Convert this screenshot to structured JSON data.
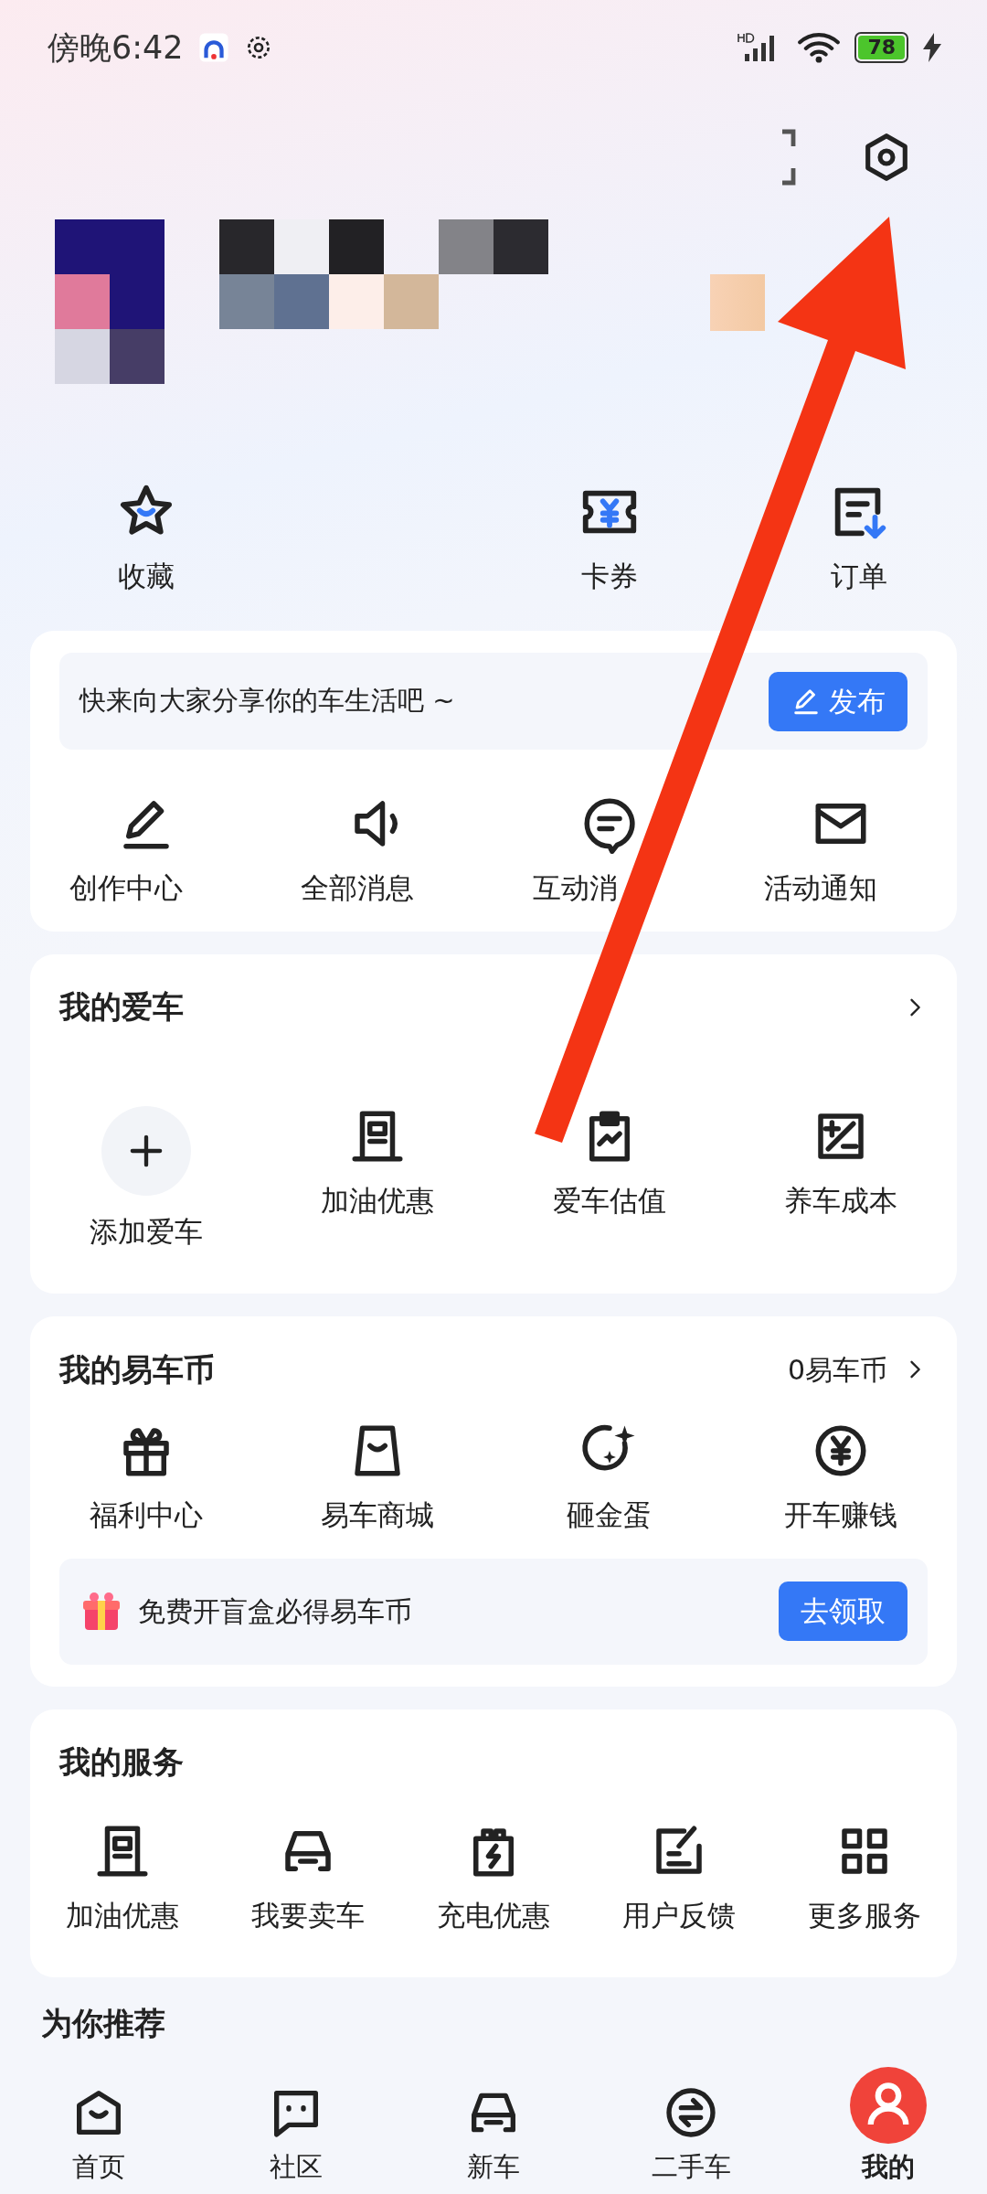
{
  "status_bar": {
    "time": "傍晚6:42",
    "battery": "78"
  },
  "quick_links": [
    {
      "label": "收藏"
    },
    {
      "label": "卡券"
    },
    {
      "label": "订单"
    }
  ],
  "share": {
    "prompt": "快来向大家分享你的车生活吧 ~",
    "button": "发布"
  },
  "messages": [
    {
      "label": "创作中心"
    },
    {
      "label": "全部消息"
    },
    {
      "label": "互动消"
    },
    {
      "label": "活动通知"
    }
  ],
  "my_car": {
    "title": "我的爱车",
    "items": [
      {
        "label": "添加爱车"
      },
      {
        "label": "加油优惠"
      },
      {
        "label": "爱车估值"
      },
      {
        "label": "养车成本"
      }
    ]
  },
  "coins": {
    "title": "我的易车币",
    "balance": "0易车币",
    "items": [
      {
        "label": "福利中心"
      },
      {
        "label": "易车商城"
      },
      {
        "label": "砸金蛋"
      },
      {
        "label": "开车赚钱"
      }
    ],
    "promo": {
      "text": "免费开盲盒必得易车币",
      "button": "去领取"
    }
  },
  "services": {
    "title": "我的服务",
    "items": [
      {
        "label": "加油优惠"
      },
      {
        "label": "我要卖车"
      },
      {
        "label": "充电优惠"
      },
      {
        "label": "用户反馈"
      },
      {
        "label": "更多服务"
      }
    ]
  },
  "recommend_title": "为你推荐",
  "nav": [
    {
      "label": "首页",
      "selected": false
    },
    {
      "label": "社区",
      "selected": false
    },
    {
      "label": "新车",
      "selected": false
    },
    {
      "label": "二手车",
      "selected": false
    },
    {
      "label": "我的",
      "selected": true
    }
  ]
}
